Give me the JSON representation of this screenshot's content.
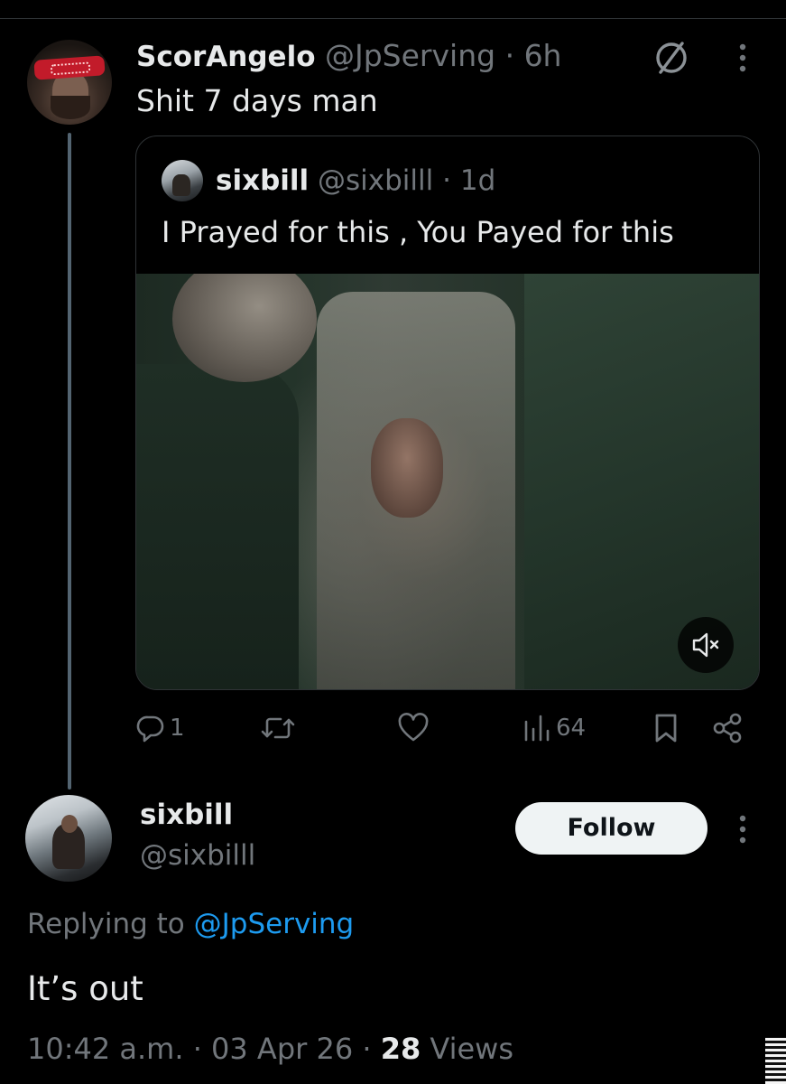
{
  "parent_tweet": {
    "display_name": "ScorAngelo",
    "handle": "@JpServing",
    "separator": "·",
    "time": "6h",
    "text": "Shit 7 days man"
  },
  "quoted_tweet": {
    "display_name": "sixbill",
    "handle": "@sixbilll",
    "separator": "·",
    "time": "1d",
    "text": "I Prayed for this , You Payed for this",
    "media": {
      "type": "video",
      "muted": true
    }
  },
  "actions": {
    "reply_count": "1",
    "retweet_count": "",
    "like_count": "",
    "views_count": "64"
  },
  "reply_tweet": {
    "display_name": "sixbill",
    "handle": "@sixbilll",
    "follow_label": "Follow",
    "replying_prefix": "Replying to",
    "replying_to": "@JpServing",
    "text": "It’s out",
    "timestamp": "10:42 a.m. · 03 Apr 26 ·",
    "views_count": "28",
    "views_label": "Views"
  },
  "icons": {
    "parent_more": "more-vertical-icon",
    "not_interested": "slash-circle-icon",
    "mute": "speaker-muted-icon",
    "reply": "reply-icon",
    "retweet": "retweet-icon",
    "like": "heart-icon",
    "views": "views-icon",
    "bookmark": "bookmark-icon",
    "share": "share-icon",
    "reply_more": "more-vertical-icon"
  },
  "colors": {
    "background": "#000000",
    "text_primary": "#e7e9ea",
    "text_secondary": "#71767b",
    "accent": "#1d9bf0",
    "border": "#2f3336",
    "follow_bg": "#eff3f4"
  }
}
